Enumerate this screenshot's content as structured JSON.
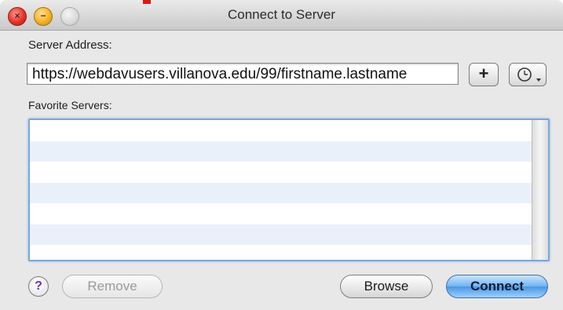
{
  "window": {
    "title": "Connect to Server",
    "traffic_lights": [
      "close",
      "minimize",
      "zoom"
    ]
  },
  "form": {
    "server_address_label": "Server Address:",
    "server_address_value": "https://webdavusers.villanova.edu/99/firstname.lastname",
    "add_button_label": "+",
    "recent_servers_icon": "clock-icon",
    "favorite_servers_label": "Favorite Servers:",
    "favorite_servers": []
  },
  "footer": {
    "help_label": "?",
    "remove_label": "Remove",
    "browse_label": "Browse",
    "connect_label": "Connect"
  },
  "colors": {
    "accent_blue": "#4a97e3",
    "list_alt_row": "#eaf0f9",
    "focus_ring": "#7ea6d8"
  }
}
